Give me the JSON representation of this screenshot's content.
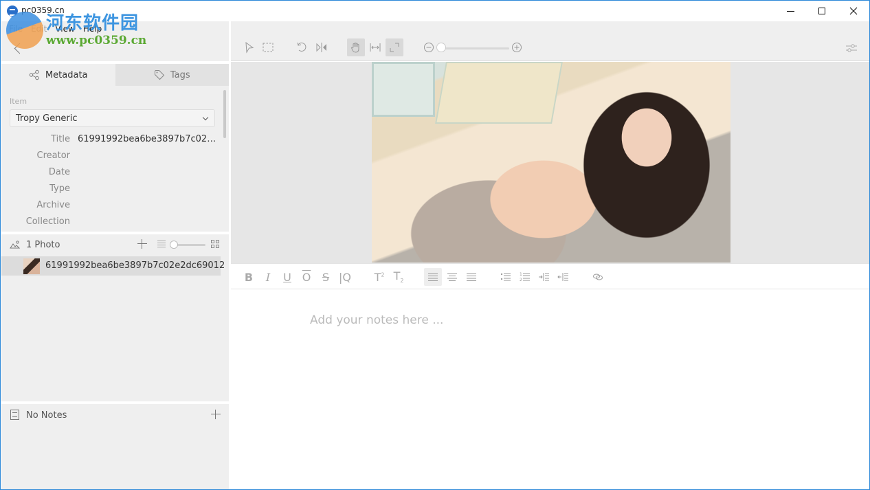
{
  "window": {
    "title": "pc0359.cn",
    "controls": {
      "minimize": "minimize",
      "maximize": "maximize",
      "close": "close"
    }
  },
  "watermark": {
    "chinese_text": "河东软件园",
    "url_text": "www.pc0359.cn"
  },
  "menubar": {
    "items": [
      "File",
      "Edit",
      "View",
      "Help"
    ]
  },
  "sidebar": {
    "tabs": [
      {
        "label": "Metadata",
        "icon": "share-icon",
        "active": true
      },
      {
        "label": "Tags",
        "icon": "tag-icon",
        "active": false
      }
    ],
    "item_label": "Item",
    "template_value": "Tropy Generic",
    "fields": [
      {
        "label": "Title",
        "value": "61991992bea6be3897b7c02e2dc..."
      },
      {
        "label": "Creator",
        "value": ""
      },
      {
        "label": "Date",
        "value": ""
      },
      {
        "label": "Type",
        "value": ""
      },
      {
        "label": "Archive",
        "value": ""
      },
      {
        "label": "Collection",
        "value": ""
      }
    ],
    "photos": {
      "count_label": "1 Photo",
      "thumbnail_zoom": 0,
      "items": [
        {
          "name": "61991992bea6be3897b7c02e2dc69012"
        }
      ]
    },
    "notes": {
      "label": "No Notes"
    }
  },
  "viewer": {
    "toolbar": {
      "tools": [
        "arrow-select",
        "rect-select",
        "rotate",
        "mirror",
        "pan",
        "fit-width",
        "fit-best"
      ],
      "active_tools": [
        "pan",
        "fit-best"
      ],
      "zoom_level": 0
    }
  },
  "editor": {
    "format_tools": [
      "bold",
      "italic",
      "underline",
      "overline",
      "strikethrough",
      "blockquote",
      "superscript",
      "subscript",
      "align-left",
      "align-center",
      "align-right",
      "bullet-list",
      "ordered-list",
      "indent",
      "outdent",
      "link"
    ],
    "active_format": "align-left",
    "placeholder": "Add your notes here ..."
  }
}
